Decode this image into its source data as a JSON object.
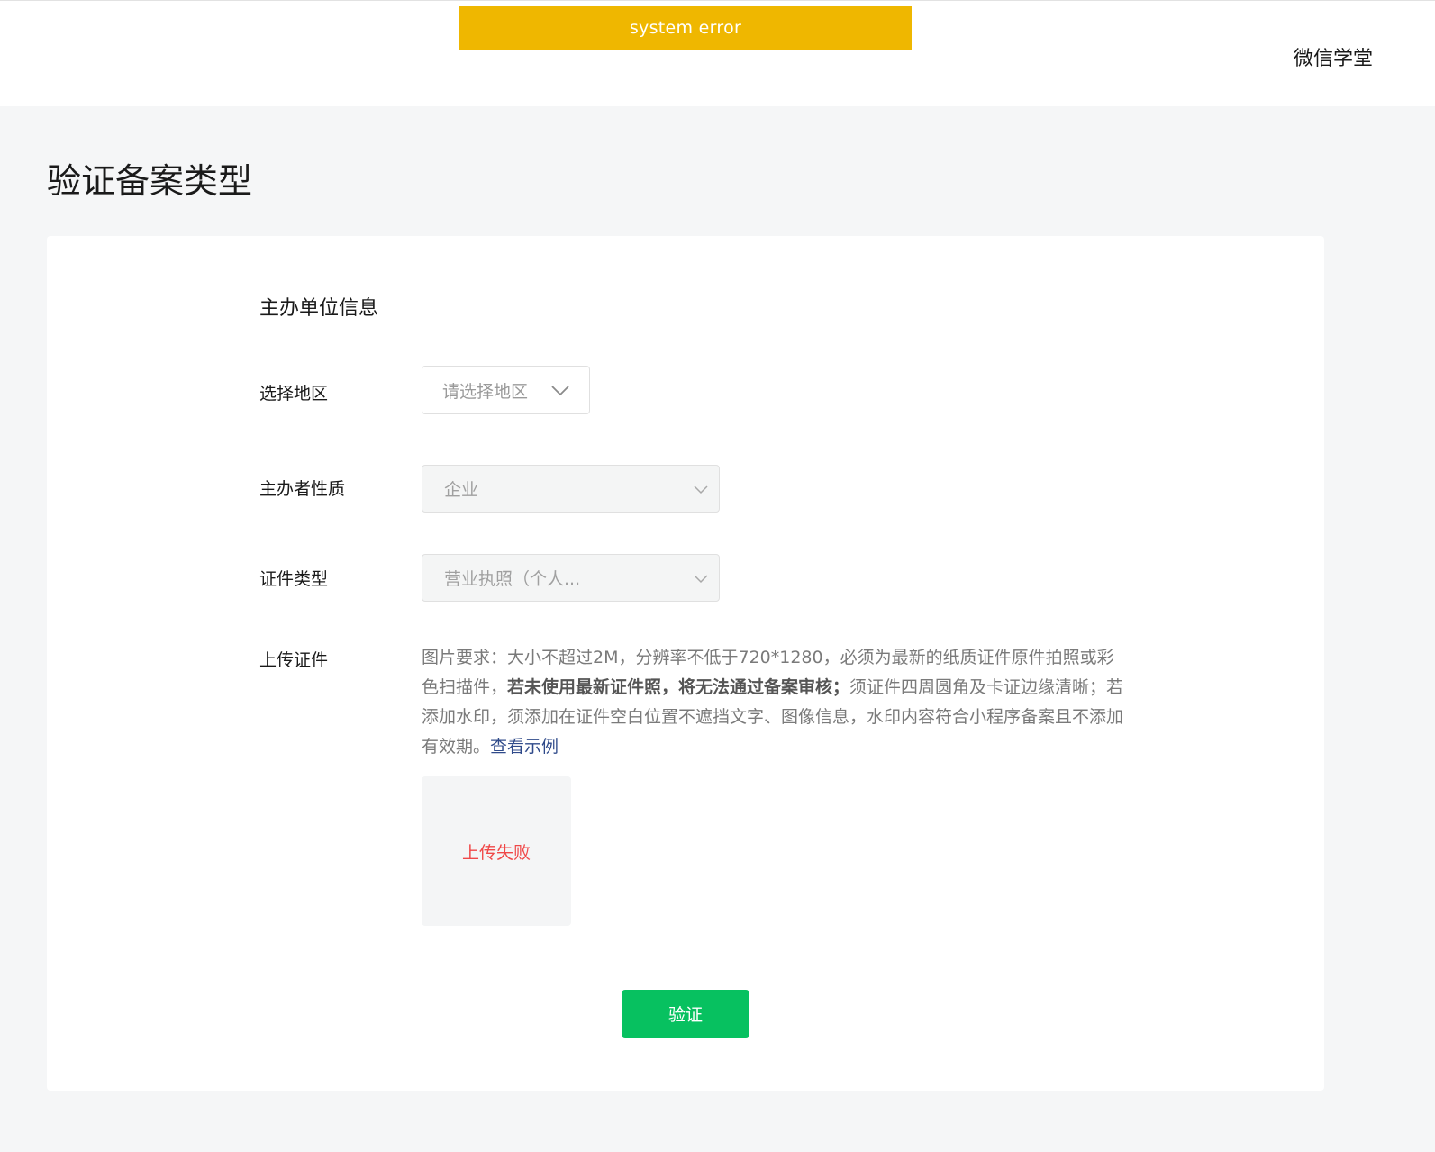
{
  "header": {
    "error_banner": "system error",
    "top_link": "微信学堂"
  },
  "page": {
    "title": "验证备案类型"
  },
  "form": {
    "section_title": "主办单位信息",
    "region": {
      "label": "选择地区",
      "placeholder": "请选择地区"
    },
    "sponsor_type": {
      "label": "主办者性质",
      "value": "企业"
    },
    "cert_type": {
      "label": "证件类型",
      "value": "营业执照（个人..."
    },
    "upload": {
      "label": "上传证件",
      "desc_part1": "图片要求：大小不超过2M，分辨率不低于720*1280，必须为最新的纸质证件原件拍照或彩色扫描件，",
      "desc_bold": "若未使用最新证件照，将无法通过备案审核；",
      "desc_part2": "须证件四周圆角及卡证边缘清晰；若添加水印，须添加在证件空白位置不遮挡文字、图像信息，水印内容符合小程序备案且不添加有效期。",
      "example_link": "查看示例",
      "status": "上传失败"
    },
    "submit_label": "验证"
  }
}
